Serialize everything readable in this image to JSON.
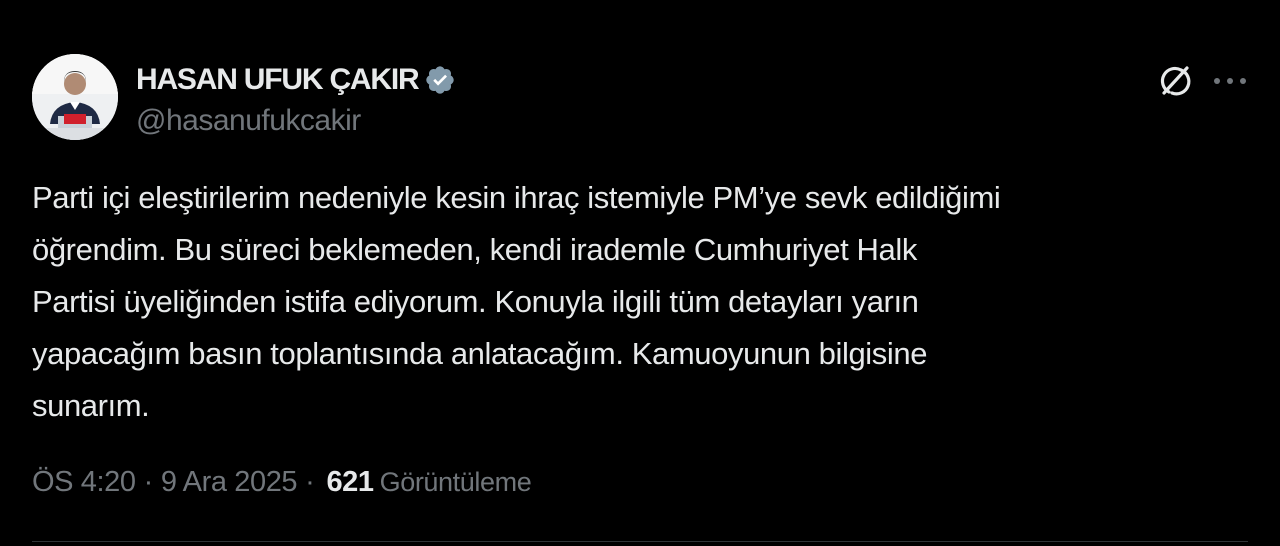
{
  "author": {
    "display_name": "HASAN UFUK ÇAKIR",
    "handle": "@hasanufukcakir",
    "verified": true,
    "verified_color": "#829aab"
  },
  "post": {
    "text": "Parti içi eleştirilerim nedeniyle kesin ihraç istemiyle PM’ye sevk edildiğimi\nöğrendim. Bu süreci beklemeden, kendi irademle Cumhuriyet Halk\nPartisi üyeliğinden istifa ediyorum. Konuyla ilgili tüm detayları yarın\nyapacağım basın toplantısında anlatacağım. Kamuoyunun bilgisine\nsunarım."
  },
  "meta": {
    "time": "ÖS 4:20",
    "separator": "·",
    "date": "9 Ara 2025",
    "views_count": "621",
    "views_label": "Görüntüleme"
  },
  "icons": {
    "grok": "grok-icon",
    "more": "more-icon",
    "verified": "verified-badge-icon"
  },
  "colors": {
    "background": "#000000",
    "text_primary": "#e7e9ea",
    "text_secondary": "#71767b"
  }
}
